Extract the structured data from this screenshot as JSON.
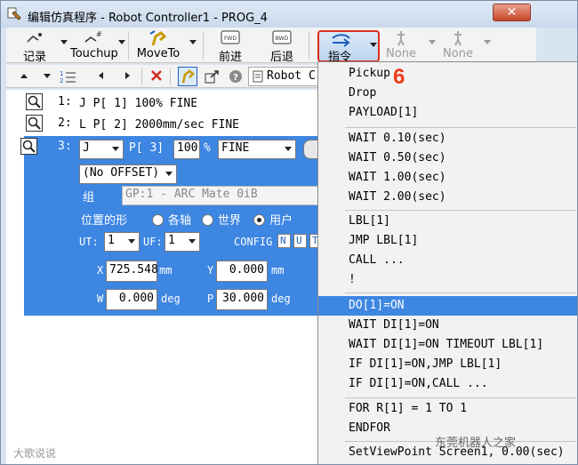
{
  "window": {
    "title": "编辑仿真程序 - Robot Controller1 - PROG_4",
    "close_label": "✕"
  },
  "toolbar": {
    "items": [
      {
        "label": "记录",
        "icon": "record-icon"
      },
      {
        "label": "Touchup",
        "icon": "touchup-icon"
      },
      {
        "label": "MoveTo",
        "icon": "moveto-icon"
      },
      {
        "label": "前进",
        "icon": "forward-icon",
        "icon_text": "FWD"
      },
      {
        "label": "后退",
        "icon": "backward-icon",
        "icon_text": "BWD"
      },
      {
        "label": "指令",
        "icon": "instruction-icon"
      },
      {
        "label": "None",
        "icon": "none-icon"
      },
      {
        "label": "None",
        "icon": "none-icon"
      }
    ],
    "annotation": "6"
  },
  "toolbar2": {
    "robot_label": "Robot C"
  },
  "program": {
    "lines": [
      {
        "num": "1:",
        "text": "J P[ 1] 100% FINE"
      },
      {
        "num": "2:",
        "text": "L P[ 2] 2000mm/sec FINE"
      }
    ],
    "editor": {
      "num": "3:",
      "motion": "J",
      "point": "P[ 3]",
      "speed": "100",
      "unit": "%",
      "term": "FINE",
      "offset": "(No OFFSET)",
      "group_label": "组",
      "group_value": "GP:1 - ARC Mate 0iB",
      "pos_label": "位置的形",
      "radio_options": [
        "各轴",
        "世界",
        "用户"
      ],
      "radio_selected": "用户",
      "ut_label": "UT:",
      "ut_value": "1",
      "uf_label": "UF:",
      "uf_value": "1",
      "config_label": "CONFIG",
      "config_flags": [
        "N",
        "U",
        "T"
      ],
      "x_label": "X",
      "x_value": "725.548",
      "x_unit": "mm",
      "y_label": "Y",
      "y_value": "0.000",
      "y_unit": "mm",
      "w_label": "W",
      "w_value": "0.000",
      "w_unit": "deg",
      "p_label": "P",
      "p_value": "30.000",
      "p_unit": "deg"
    }
  },
  "menu": {
    "groups": [
      [
        "Pickup",
        "Drop",
        "PAYLOAD[1]"
      ],
      [
        "WAIT 0.10(sec)",
        "WAIT 0.50(sec)",
        "WAIT 1.00(sec)",
        "WAIT 2.00(sec)"
      ],
      [
        "LBL[1]",
        "JMP LBL[1]",
        "CALL ...",
        "!"
      ],
      [
        "DO[1]=ON",
        "WAIT DI[1]=ON",
        "WAIT DI[1]=ON TIMEOUT LBL[1]",
        "IF DI[1]=ON,JMP LBL[1]",
        "IF DI[1]=ON,CALL ..."
      ],
      [
        "FOR R[1] = 1 TO 1",
        "ENDFOR"
      ],
      [
        "SetViewPoint  Screen1, 0.00(sec)"
      ]
    ],
    "selected": "DO[1]=ON"
  },
  "watermarks": {
    "left": "大歌说说",
    "right": "东莞机器人之家"
  },
  "colors": {
    "selection": "#3d86e2",
    "highlight_border": "#e02b1c",
    "annotation": "#ef3b17"
  }
}
